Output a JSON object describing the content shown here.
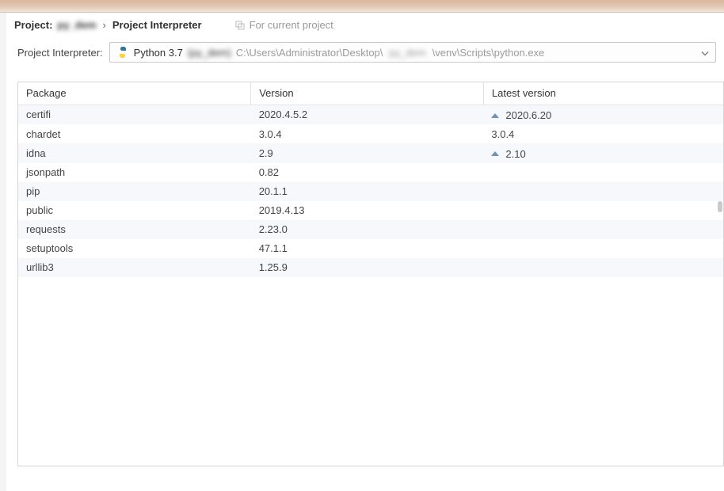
{
  "breadcrumb": {
    "project_prefix": "Project:",
    "project_name": "py_dem",
    "chevron": "›",
    "interpreter_label": "Project Interpreter",
    "for_current": "For current project"
  },
  "interpreter": {
    "label": "Project Interpreter:",
    "name": "Python 3.7",
    "project_in_parens": "(py_dem)",
    "path_before": "C:\\Users\\Administrator\\Desktop\\",
    "path_blur": "py_dem",
    "path_after": "\\venv\\Scripts\\python.exe"
  },
  "table": {
    "headers": {
      "package": "Package",
      "version": "Version",
      "latest": "Latest version"
    },
    "rows": [
      {
        "package": "certifi",
        "version": "2020.4.5.2",
        "latest": "2020.6.20",
        "upgrade": true
      },
      {
        "package": "chardet",
        "version": "3.0.4",
        "latest": "3.0.4",
        "upgrade": false
      },
      {
        "package": "idna",
        "version": "2.9",
        "latest": "2.10",
        "upgrade": true
      },
      {
        "package": "jsonpath",
        "version": "0.82",
        "latest": "",
        "upgrade": false
      },
      {
        "package": "pip",
        "version": "20.1.1",
        "latest": "",
        "upgrade": false
      },
      {
        "package": "public",
        "version": "2019.4.13",
        "latest": "",
        "upgrade": false
      },
      {
        "package": "requests",
        "version": "2.23.0",
        "latest": "",
        "upgrade": false
      },
      {
        "package": "setuptools",
        "version": "47.1.1",
        "latest": "",
        "upgrade": false
      },
      {
        "package": "urllib3",
        "version": "1.25.9",
        "latest": "",
        "upgrade": false
      }
    ]
  }
}
